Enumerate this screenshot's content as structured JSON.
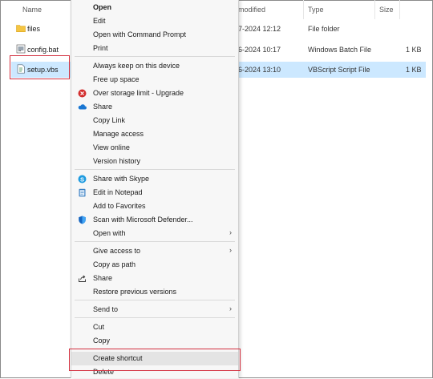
{
  "columns": {
    "name": "Name",
    "modified": "modified",
    "type": "Type",
    "size": "Size"
  },
  "files": [
    {
      "name": "files",
      "date": "7-2024 12:12",
      "type": "File folder",
      "size": "",
      "icon": "folder-icon"
    },
    {
      "name": "config.bat",
      "date": "6-2024 10:17",
      "type": "Windows Batch File",
      "size": "1 KB",
      "icon": "batch-file-icon"
    },
    {
      "name": "setup.vbs",
      "date": "6-2024 13:10",
      "type": "VBScript Script File",
      "size": "1 KB",
      "icon": "script-file-icon"
    }
  ],
  "menu": {
    "open": "Open",
    "edit": "Edit",
    "open_cmd": "Open with Command Prompt",
    "print": "Print",
    "keep_on_device": "Always keep on this device",
    "free_space": "Free up space",
    "over_storage": "Over storage limit - Upgrade",
    "share_onedrive": "Share",
    "copy_link": "Copy Link",
    "manage_access": "Manage access",
    "view_online": "View online",
    "version_history": "Version history",
    "share_skype": "Share with Skype",
    "edit_notepad": "Edit in Notepad",
    "add_favorites": "Add to Favorites",
    "scan_defender": "Scan with Microsoft Defender...",
    "open_with": "Open with",
    "give_access": "Give access to",
    "copy_path": "Copy as path",
    "share": "Share",
    "restore_versions": "Restore previous versions",
    "send_to": "Send to",
    "cut": "Cut",
    "copy": "Copy",
    "create_shortcut": "Create shortcut",
    "delete": "Delete",
    "submenu_arrow": "›"
  },
  "colors": {
    "selection": "#cce8ff",
    "highlight": "#d32f3f",
    "menu_bg": "#f7f7f7"
  }
}
